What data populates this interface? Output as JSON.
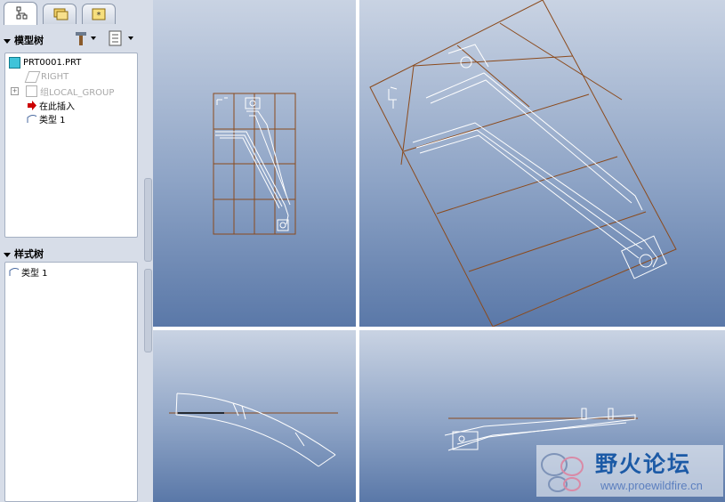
{
  "tabs": [
    {
      "icon": "model-tree-icon"
    },
    {
      "icon": "folder-browser-icon"
    },
    {
      "icon": "favorites-icon"
    }
  ],
  "model_tree": {
    "header": "模型树",
    "items": [
      {
        "label": "PRT0001.PRT",
        "icon": "part-icon",
        "grayed": false
      },
      {
        "label": "RIGHT",
        "icon": "datum-plane-icon",
        "grayed": true
      },
      {
        "label": "组LOCAL_GROUP",
        "icon": "group-icon",
        "grayed": true
      },
      {
        "label": "在此插入",
        "icon": "insert-here-arrow-icon",
        "grayed": false
      },
      {
        "label": "类型  1",
        "icon": "style-feature-icon",
        "grayed": false
      }
    ]
  },
  "style_tree": {
    "header": "样式树",
    "items": [
      {
        "label": "类型  1",
        "icon": "style-feature-icon"
      }
    ]
  },
  "watermark": {
    "title": "野火论坛",
    "url": "www.proewildfire.cn"
  },
  "colors": {
    "grid": "#8b4a1c",
    "geometry": "#ffffff",
    "accent": "#cc0000"
  }
}
